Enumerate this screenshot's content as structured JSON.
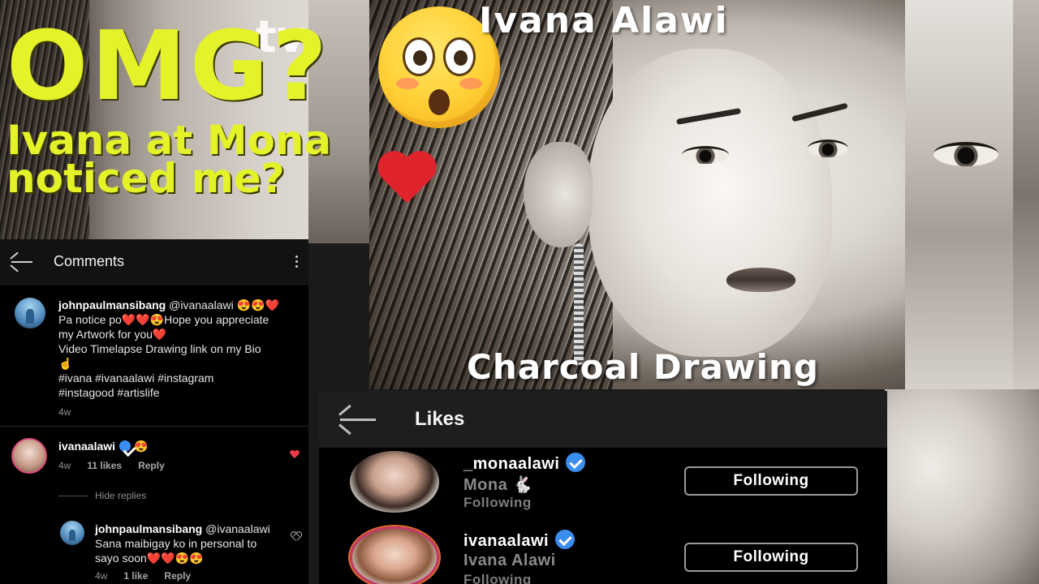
{
  "thumbnail": {
    "headline": "OMG?",
    "subline_1": "Ivana at Mona",
    "subline_2": "noticed me?",
    "portrait_title": "Ivana Alawi",
    "portrait_caption": "Charcoal Drawing",
    "watermark": "tv",
    "accent_color": "#e4f22a"
  },
  "comments_panel": {
    "title": "Comments",
    "comment_1": {
      "username": "johnpaulmansibang",
      "mention": "@ivanaalawi 😍😍❤️",
      "line_1": "Pa notice po❤️❤️😍Hope you appreciate",
      "line_2": "my Artwork for you❤️",
      "line_3": "Video Timelapse Drawing link on my Bio",
      "line_4": "☝",
      "line_5": "#ivana #ivanaalawi  #instagram",
      "line_6": "#instagood  #artislife",
      "time": "4w"
    },
    "comment_2": {
      "username": "ivanaalawi",
      "text": "😍",
      "time": "4w",
      "likes": "11 likes",
      "reply": "Reply",
      "liked": true
    },
    "hide_replies": "Hide replies",
    "reply_1": {
      "username": "johnpaulmansibang",
      "mention": "@ivanaalawi",
      "line_1": "Sana maibigay ko in personal to",
      "line_2": "sayo soon❤️❤️😍😍",
      "time": "4w",
      "likes": "1 like",
      "reply": "Reply"
    }
  },
  "likes_panel": {
    "title": "Likes",
    "users": [
      {
        "username": "_monaalawi",
        "fullname": "Mona 🐇",
        "status": "Following",
        "button": "Following",
        "verified": true
      },
      {
        "username": "ivanaalawi",
        "fullname": "Ivana Alawi",
        "status": "Following",
        "button": "Following",
        "verified": true
      }
    ]
  }
}
